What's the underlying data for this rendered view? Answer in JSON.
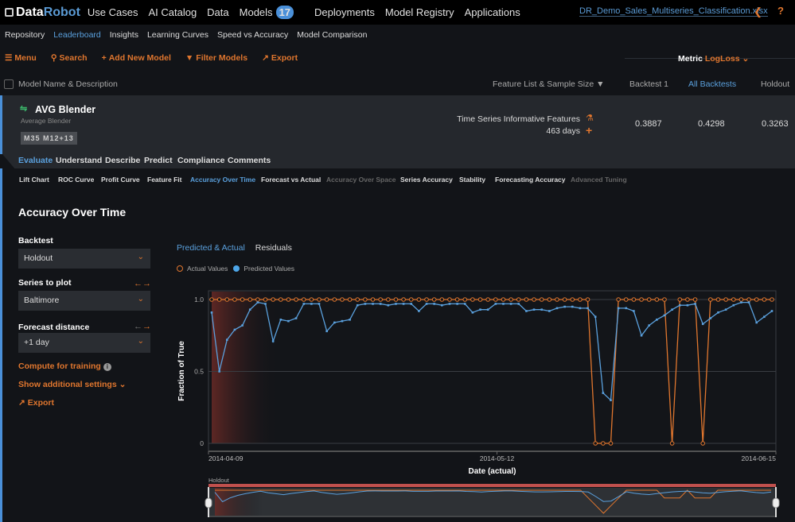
{
  "topbar": {
    "logo_data": "Data",
    "logo_robot": "Robot",
    "nav": [
      {
        "label": "Use Cases"
      },
      {
        "label": "AI Catalog"
      },
      {
        "label": "Data"
      },
      {
        "label": "Models",
        "badge": "17",
        "active": true
      },
      {
        "label": "Deployments"
      },
      {
        "label": "Model Registry"
      },
      {
        "label": "Applications"
      }
    ],
    "project_file": "DR_Demo_Sales_Multiseries_Classification.xlsx",
    "share_icon": "share-icon",
    "help_icon": "?"
  },
  "subnav": {
    "items": [
      "Repository",
      "Leaderboard",
      "Insights",
      "Learning Curves",
      "Speed vs Accuracy",
      "Model Comparison"
    ],
    "active": "Leaderboard"
  },
  "toolbar": {
    "menu": "Menu",
    "search": "Search",
    "add_model": "Add New Model",
    "filter": "Filter Models",
    "export": "Export"
  },
  "metric": {
    "label": "Metric",
    "value": "LogLoss"
  },
  "columns": {
    "name": "Model Name & Description",
    "feature_list": "Feature List & Sample Size",
    "backtest1": "Backtest 1",
    "all_backtests": "All Backtests",
    "holdout": "Holdout"
  },
  "model": {
    "name": "AVG Blender",
    "description": "Average Blender",
    "tag": "M35  M12+13",
    "feature_list": "Time Series Informative Features",
    "sample_size": "463 days",
    "backtest1": "0.3887",
    "all_backtests": "0.4298",
    "holdout": "0.3263"
  },
  "eval_tabs": [
    "Evaluate",
    "Understand",
    "Describe",
    "Predict",
    "Compliance",
    "Comments"
  ],
  "sub_tabs": [
    {
      "label": "Lift Chart"
    },
    {
      "label": "ROC Curve"
    },
    {
      "label": "Profit Curve"
    },
    {
      "label": "Feature Fit"
    },
    {
      "label": "Accuracy Over Time",
      "active": true
    },
    {
      "label": "Forecast vs Actual"
    },
    {
      "label": "Accuracy Over Space",
      "disabled": true
    },
    {
      "label": "Series Accuracy"
    },
    {
      "label": "Stability"
    },
    {
      "label": "Forecasting Accuracy"
    },
    {
      "label": "Advanced Tuning",
      "disabled": true
    }
  ],
  "panel": {
    "title": "Accuracy Over Time",
    "backtest_label": "Backtest",
    "backtest_value": "Holdout",
    "series_label": "Series to plot",
    "series_value": "Baltimore",
    "forecast_label": "Forecast distance",
    "forecast_value": "+1 day",
    "compute_training": "Compute for training",
    "additional_settings": "Show additional settings",
    "export": "Export"
  },
  "chart_tabs": [
    "Predicted & Actual",
    "Residuals"
  ],
  "chart_data": {
    "type": "line",
    "title": "Accuracy Over Time",
    "xlabel": "Date (actual)",
    "ylabel": "Fraction of True",
    "ylim": [
      0,
      1
    ],
    "yticks": [
      "0",
      "0.5",
      "1.0"
    ],
    "xticks": [
      "2014-04-09",
      "2014-05-12",
      "2014-06-15"
    ],
    "x_start": "2014-04-09",
    "x_end": "2014-06-15",
    "grid": true,
    "legend": "top-left",
    "highlight_region_label": "Holdout",
    "series": [
      {
        "name": "Actual Values",
        "color": "#e0762e",
        "values": [
          1,
          1,
          1,
          1,
          1,
          1,
          1,
          1,
          1,
          1,
          1,
          1,
          1,
          1,
          1,
          1,
          1,
          1,
          1,
          1,
          1,
          1,
          1,
          1,
          1,
          1,
          1,
          1,
          1,
          1,
          1,
          1,
          1,
          1,
          1,
          1,
          1,
          1,
          1,
          1,
          1,
          1,
          1,
          1,
          1,
          1,
          1,
          1,
          1,
          1,
          0,
          0,
          0,
          1,
          1,
          1,
          1,
          1,
          1,
          1,
          0,
          1,
          1,
          1,
          0,
          1,
          1,
          1,
          1,
          1,
          1,
          1,
          1,
          1
        ]
      },
      {
        "name": "Predicted Values",
        "color": "#5aa0dd",
        "values": [
          0.91,
          0.5,
          0.72,
          0.79,
          0.82,
          0.93,
          0.98,
          0.97,
          0.71,
          0.86,
          0.85,
          0.87,
          0.97,
          0.97,
          0.97,
          0.78,
          0.84,
          0.85,
          0.86,
          0.96,
          0.97,
          0.97,
          0.97,
          0.96,
          0.97,
          0.97,
          0.97,
          0.92,
          0.97,
          0.97,
          0.96,
          0.97,
          0.97,
          0.97,
          0.91,
          0.93,
          0.93,
          0.97,
          0.97,
          0.97,
          0.97,
          0.92,
          0.93,
          0.93,
          0.92,
          0.94,
          0.95,
          0.95,
          0.94,
          0.94,
          0.88,
          0.35,
          0.3,
          0.94,
          0.94,
          0.92,
          0.75,
          0.82,
          0.86,
          0.89,
          0.93,
          0.96,
          0.96,
          0.97,
          0.83,
          0.87,
          0.91,
          0.93,
          0.96,
          0.98,
          0.98,
          0.84,
          0.88,
          0.92
        ]
      }
    ]
  }
}
